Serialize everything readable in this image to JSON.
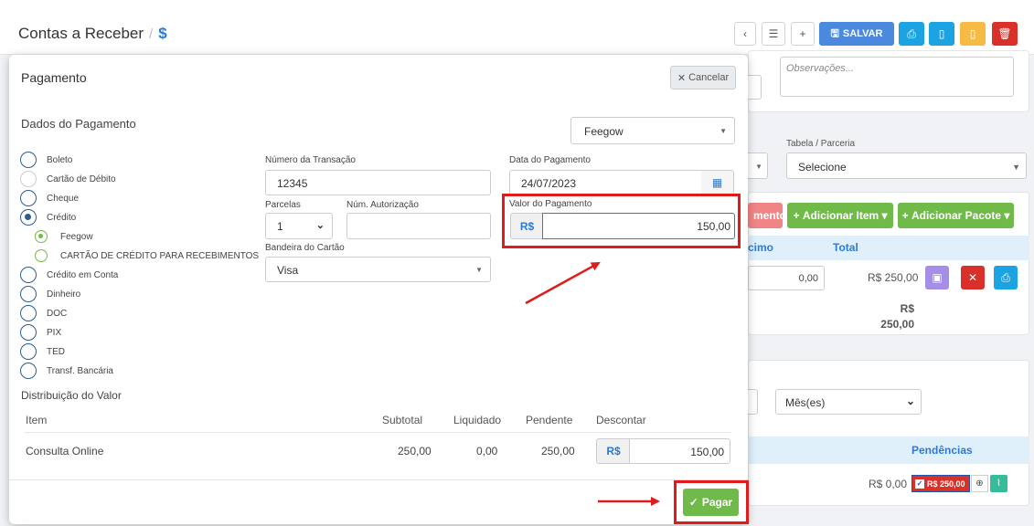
{
  "page": {
    "title": "Contas a Receber",
    "title_sep": "/",
    "title_icon": "$",
    "toolbar": {
      "salvar_label": "SALVAR",
      "back_icon": "chevron-left",
      "list_icon": "list",
      "add_icon": "plus",
      "print_icon": "printer",
      "doc_icon": "document",
      "doc2_icon": "document-yellow",
      "trash_icon": "trash"
    },
    "observacoes_placeholder": "Observações...",
    "tabela_label": "Tabela / Parceria",
    "tabela_value": "Selecione",
    "desconto_btn_partial": "mento",
    "adicionar_item": "Adicionar Item",
    "adicionar_pacote": "Adicionar Pacote",
    "col_acrescimo_partial": "cimo",
    "col_total": "Total",
    "row_acrescimo": "0,00",
    "row_total": "R$ 250,00",
    "grand_total_currency": "R$",
    "grand_total_value": "250,00",
    "periodo_value": "Mês(es)",
    "col_pendencias": "Pendências",
    "bottom_value": "R$ 0,00",
    "pendencia_badge": "R$ 250,00"
  },
  "modal": {
    "title": "Pagamento",
    "cancel_label": "Cancelar",
    "dados_title": "Dados do Pagamento",
    "gateway_select": "Feegow",
    "payment_methods": [
      {
        "label": "Boleto",
        "checked": false
      },
      {
        "label": "Cartão de Débito",
        "checked": false
      },
      {
        "label": "Cheque",
        "checked": false
      },
      {
        "label": "Crédito",
        "checked": true
      }
    ],
    "credit_options": [
      {
        "label": "Feegow",
        "checked": true
      },
      {
        "label": "CARTÃO DE CRÉDITO PARA RECEBIMENTOS",
        "checked": false
      }
    ],
    "payment_methods_2": [
      {
        "label": "Crédito em Conta"
      },
      {
        "label": "Dinheiro"
      },
      {
        "label": "DOC"
      },
      {
        "label": "PIX"
      },
      {
        "label": "TED"
      },
      {
        "label": "Transf. Bancária"
      }
    ],
    "numero_transacao_label": "Número da Transação",
    "numero_transacao_value": "12345",
    "parcelas_label": "Parcelas",
    "parcelas_value": "1",
    "num_autorizacao_label": "Núm. Autorização",
    "num_autorizacao_value": "",
    "bandeira_label": "Bandeira do Cartão",
    "bandeira_value": "Visa",
    "data_pagamento_label": "Data do Pagamento",
    "data_pagamento_value": "24/07/2023",
    "valor_pagamento_label": "Valor do Pagamento",
    "currency": "R$",
    "valor_pagamento_value": "150,00",
    "distribuicao_title": "Distribuição do Valor",
    "dist_columns": [
      "Item",
      "Subtotal",
      "Liquidado",
      "Pendente",
      "Descontar"
    ],
    "dist_row": {
      "item": "Consulta Online",
      "subtotal": "250,00",
      "liquidado": "0,00",
      "pendente": "250,00",
      "descontar": "150,00"
    },
    "pagar_label": "Pagar"
  },
  "colors": {
    "primary": "#4a89dc",
    "success": "#70ba4a",
    "danger": "#d9302a",
    "info": "#1ba3e2",
    "highlight_red": "#e01b1b"
  }
}
